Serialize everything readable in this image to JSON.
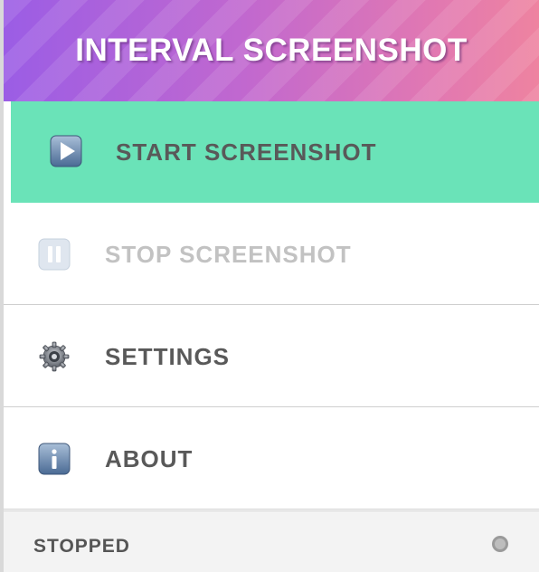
{
  "header": {
    "title": "INTERVAL SCREENSHOT"
  },
  "menu": {
    "items": [
      {
        "label": "START SCREENSHOT",
        "icon": "play-icon",
        "state": "active"
      },
      {
        "label": "STOP SCREENSHOT",
        "icon": "pause-icon",
        "state": "disabled"
      },
      {
        "label": "SETTINGS",
        "icon": "gear-icon",
        "state": "normal"
      },
      {
        "label": "ABOUT",
        "icon": "info-icon",
        "state": "normal"
      }
    ]
  },
  "footer": {
    "status": "STOPPED",
    "status_indicator": "inactive-dot"
  },
  "colors": {
    "header_gradient_start": "#9b5de5",
    "header_gradient_end": "#ee83a0",
    "active_item": "#6ae3b8",
    "label_text": "#595959",
    "disabled_text": "#c2c2c2",
    "footer_bg": "#f3f3f3"
  }
}
